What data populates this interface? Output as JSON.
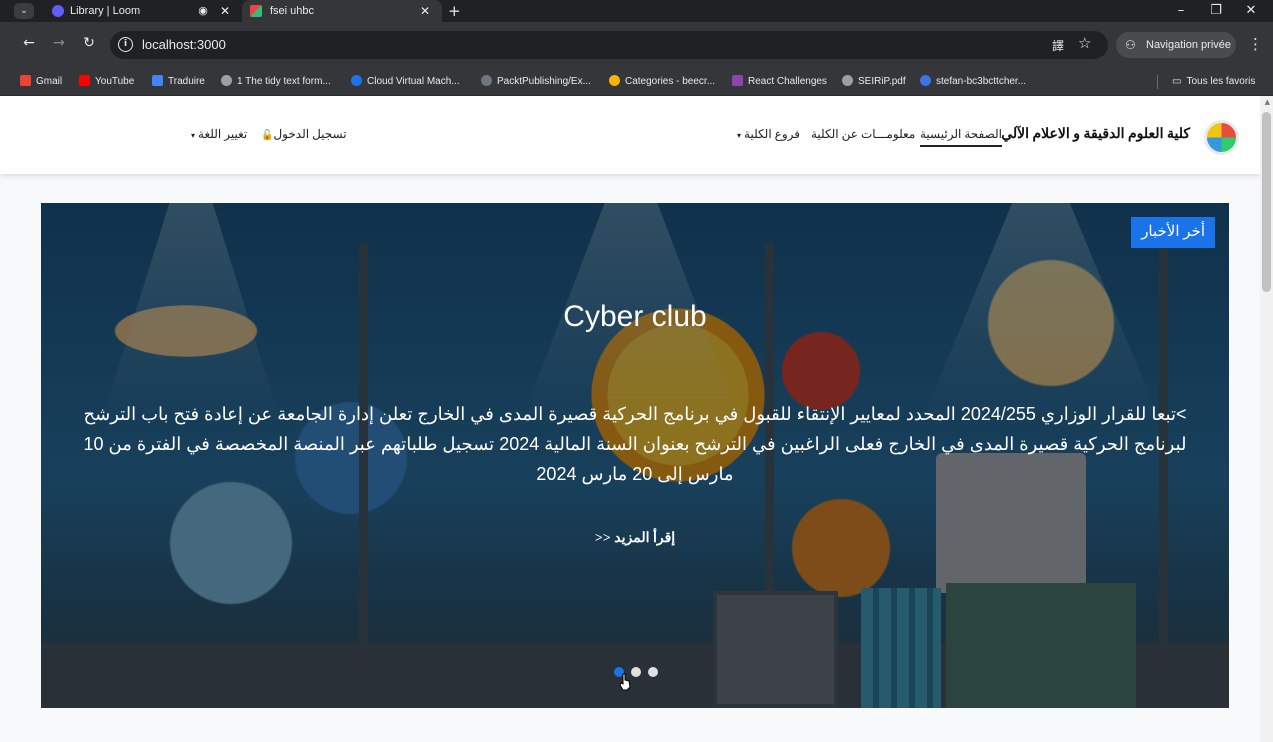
{
  "browser": {
    "tabs": [
      {
        "title": "Library | Loom"
      },
      {
        "title": "fsei uhbc"
      }
    ],
    "tab_dropdown_glyph": "⌄",
    "recording_glyph": "◉",
    "close_glyph": "✕",
    "new_tab_glyph": "+",
    "window_controls": {
      "minimize": "–",
      "maximize": "❐",
      "close": "✕"
    },
    "nav": {
      "back": "←",
      "forward": "→",
      "reload": "↻"
    },
    "url": "localhost:3000",
    "translate_glyph": "譯",
    "star_glyph": "☆",
    "incognito_glyph": "⚇",
    "incognito_label": "Navigation privée",
    "menu_glyph": "⋮",
    "bookmarks": [
      {
        "label": "Gmail",
        "color": "#ea4335"
      },
      {
        "label": "YouTube",
        "color": "#ff0000"
      },
      {
        "label": "Traduire",
        "color": "#4285f4"
      },
      {
        "label": "1 The tidy text form...",
        "color": "#9aa0a6"
      },
      {
        "label": "Cloud Virtual Mach...",
        "color": "#1a73e8"
      },
      {
        "label": "PacktPublishing/Ex...",
        "color": "#6e7681"
      },
      {
        "label": "Categories - beecr...",
        "color": "#f7b500"
      },
      {
        "label": "React Challenges",
        "color": "#8e44ad"
      },
      {
        "label": "SEIRiP.pdf",
        "color": "#9aa0a6"
      },
      {
        "label": "stefan-bc3bcttcher...",
        "color": "#3f72e5"
      }
    ],
    "all_bookmarks_label": "Tous les favoris",
    "folder_glyph": "▭"
  },
  "site": {
    "brand": "كلية العلوم الدقيقة و الاعلام الآلي",
    "nav": {
      "home": "الصفحة الرئيسية",
      "about": "معلومـــات عن الكلية",
      "branches": "فروع الكلية",
      "login": "تسجيل الدخول",
      "language": "تغيير اللغة"
    },
    "caret_glyph": "▾",
    "lock_glyph": "🔓",
    "accent_color": "#1a73e8"
  },
  "carousel": {
    "badge": "أخر الأخبار",
    "title": "Cyber club",
    "text": ">تبعا للقرار الوزاري 2024/255 المحدد لمعايير الإنتقاء للقبول في برنامج الحركية قصيرة المدى في الخارج تعلن إدارة الجامعة عن إعادة فتح باب الترشح لبرنامج الحركية قصيرة المدى في الخارج فعلى الراغبين في الترشح بعنوان السنة المالية 2024 تسجيل طلباتهم عبر المنصة المخصصة في الفترة من 10 مارس إلى 20 مارس 2024",
    "read_more": "إقرأ المزيد <<",
    "slide_count": 3,
    "active_slide": 1
  }
}
